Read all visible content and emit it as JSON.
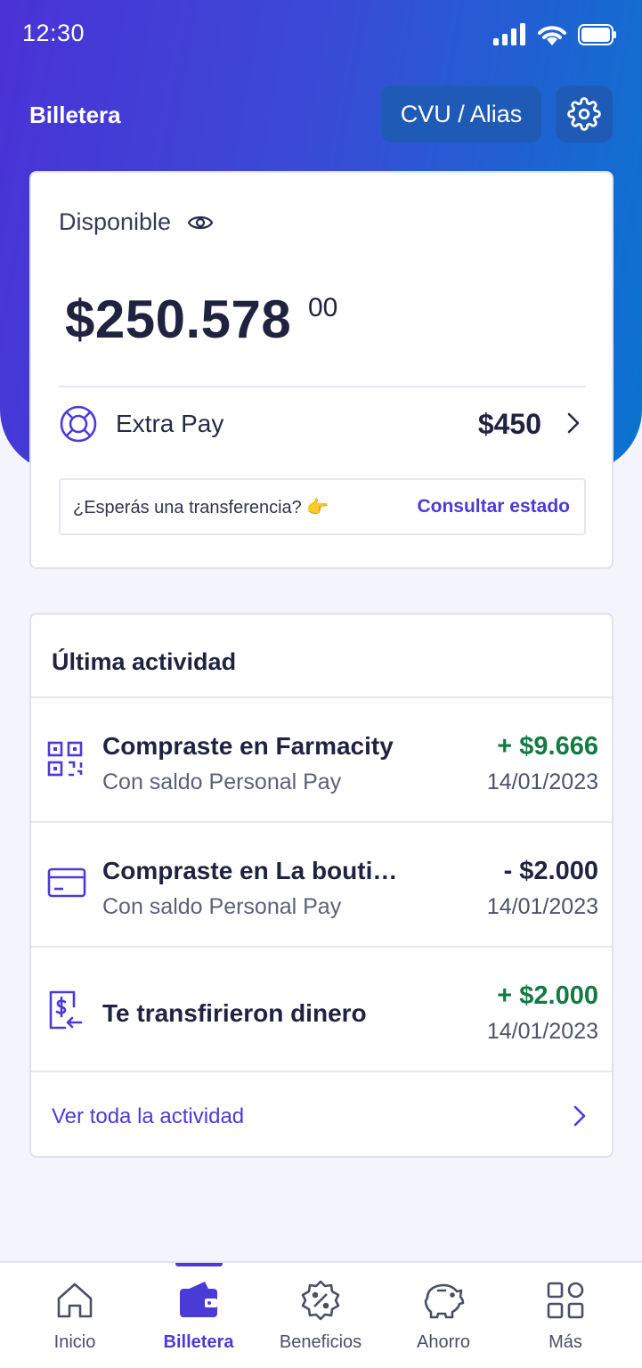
{
  "status_bar": {
    "time": "12:30"
  },
  "header": {
    "title": "Billetera",
    "cvu_label": "CVU / Alias"
  },
  "balance": {
    "label": "Disponible",
    "amount": "$250.578",
    "cents": "00",
    "extrapay_label": "Extra Pay",
    "extrapay_amount": "$450",
    "transfer_question": "¿Esperás una transferencia? 👉",
    "transfer_link": "Consultar estado"
  },
  "activity": {
    "title": "Última actividad",
    "items": [
      {
        "icon": "qr-code-icon",
        "title": "Compraste en Farmacity",
        "subtitle": "Con saldo Personal Pay",
        "amount": "+ $9.666",
        "date": "14/01/2023",
        "sign": "positive"
      },
      {
        "icon": "credit-card-icon",
        "title": "Compraste en La bouti…",
        "subtitle": "Con saldo Personal Pay",
        "amount": "- $2.000",
        "date": "14/01/2023",
        "sign": "negative"
      },
      {
        "icon": "transfer-receive-icon",
        "title": "Te transfirieron dinero",
        "subtitle": "",
        "amount": "+ $2.000",
        "date": "14/01/2023",
        "sign": "positive"
      }
    ],
    "see_all": "Ver toda la actividad"
  },
  "nav": {
    "items": [
      {
        "label": "Inicio",
        "icon": "home-icon"
      },
      {
        "label": "Billetera",
        "icon": "wallet-icon",
        "active": true
      },
      {
        "label": "Beneficios",
        "icon": "discount-badge-icon"
      },
      {
        "label": "Ahorro",
        "icon": "piggy-bank-icon"
      },
      {
        "label": "Más",
        "icon": "grid-icon"
      }
    ]
  },
  "colors": {
    "accent": "#4b3bd6",
    "positive": "#137a45",
    "gradient_start": "#4a32d6",
    "gradient_end": "#0a74cf"
  }
}
